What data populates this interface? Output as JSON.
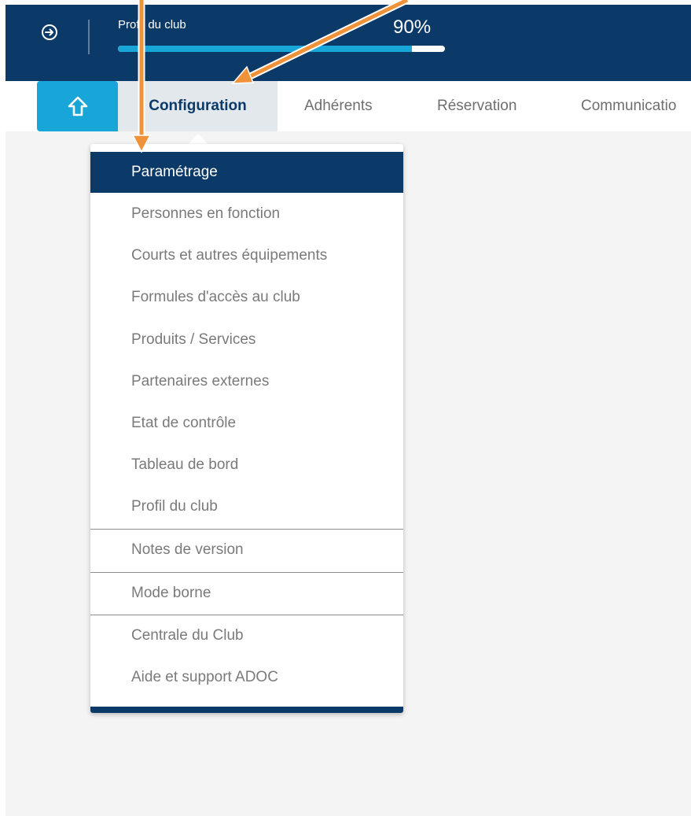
{
  "colors": {
    "navy": "#0b3968",
    "accent": "#18a5d8",
    "annotation": "#f0923a"
  },
  "header": {
    "exit_icon": "arrow-right-circle-icon",
    "profile_label": "Profil du club",
    "profile_percent": "90%",
    "profile_progress": 0.9
  },
  "nav": {
    "home_icon": "home-arrow-up-icon",
    "tabs": [
      "Configuration",
      "Adhérents",
      "Réservation",
      "Communicatio"
    ],
    "active_tab": "Configuration"
  },
  "menu": {
    "items": [
      "Paramétrage",
      "Personnes en fonction",
      "Courts et autres équipements",
      "Formules d'accès au club",
      "Produits / Services",
      "Partenaires externes",
      "Etat de contrôle",
      "Tableau de bord",
      "Profil du club",
      "Notes de version",
      "Mode borne",
      "Centrale du Club",
      "Aide et support ADOC"
    ],
    "active_item": "Paramétrage"
  }
}
